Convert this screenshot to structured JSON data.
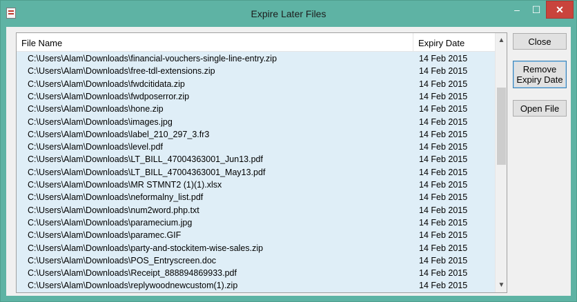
{
  "window": {
    "title": "Expire Later Files",
    "minimize": "–",
    "maximize": "☐",
    "close": "✕"
  },
  "list": {
    "columns": {
      "name": "File Name",
      "date": "Expiry Date"
    },
    "rows": [
      {
        "name": "C:\\Users\\Alam\\Downloads\\financial-vouchers-single-line-entry.zip",
        "date": "14 Feb 2015"
      },
      {
        "name": "C:\\Users\\Alam\\Downloads\\free-tdl-extensions.zip",
        "date": "14 Feb 2015"
      },
      {
        "name": "C:\\Users\\Alam\\Downloads\\fwdcitidata.zip",
        "date": "14 Feb 2015"
      },
      {
        "name": "C:\\Users\\Alam\\Downloads\\fwdposerror.zip",
        "date": "14 Feb 2015"
      },
      {
        "name": "C:\\Users\\Alam\\Downloads\\hone.zip",
        "date": "14 Feb 2015"
      },
      {
        "name": "C:\\Users\\Alam\\Downloads\\images.jpg",
        "date": "14 Feb 2015"
      },
      {
        "name": "C:\\Users\\Alam\\Downloads\\label_210_297_3.fr3",
        "date": "14 Feb 2015"
      },
      {
        "name": "C:\\Users\\Alam\\Downloads\\level.pdf",
        "date": "14 Feb 2015"
      },
      {
        "name": "C:\\Users\\Alam\\Downloads\\LT_BILL_47004363001_Jun13.pdf",
        "date": "14 Feb 2015"
      },
      {
        "name": "C:\\Users\\Alam\\Downloads\\LT_BILL_47004363001_May13.pdf",
        "date": "14 Feb 2015"
      },
      {
        "name": "C:\\Users\\Alam\\Downloads\\MR STMNT2 (1)(1).xlsx",
        "date": "14 Feb 2015"
      },
      {
        "name": "C:\\Users\\Alam\\Downloads\\neformalny_list.pdf",
        "date": "14 Feb 2015"
      },
      {
        "name": "C:\\Users\\Alam\\Downloads\\num2word.php.txt",
        "date": "14 Feb 2015"
      },
      {
        "name": "C:\\Users\\Alam\\Downloads\\paramecium.jpg",
        "date": "14 Feb 2015"
      },
      {
        "name": "C:\\Users\\Alam\\Downloads\\paramec.GIF",
        "date": "14 Feb 2015"
      },
      {
        "name": "C:\\Users\\Alam\\Downloads\\party-and-stockitem-wise-sales.zip",
        "date": "14 Feb 2015"
      },
      {
        "name": "C:\\Users\\Alam\\Downloads\\POS_Entryscreen.doc",
        "date": "14 Feb 2015"
      },
      {
        "name": "C:\\Users\\Alam\\Downloads\\Receipt_888894869933.pdf",
        "date": "14 Feb 2015"
      },
      {
        "name": "C:\\Users\\Alam\\Downloads\\replywoodnewcustom(1).zip",
        "date": "14 Feb 2015"
      }
    ]
  },
  "buttons": {
    "close": "Close",
    "remove_line1": "Remove",
    "remove_line2": "Expiry Date",
    "open": "Open File"
  },
  "scrollbar": {
    "up": "▲",
    "down": "▼"
  },
  "colors": {
    "title_bar": "#5eb3a4",
    "selection_bg": "#dfeef7",
    "close_button": "#c9443c"
  },
  "icons": {
    "app": "app-icon",
    "minimize": "minimize-icon",
    "maximize": "maximize-icon",
    "close": "close-icon"
  }
}
